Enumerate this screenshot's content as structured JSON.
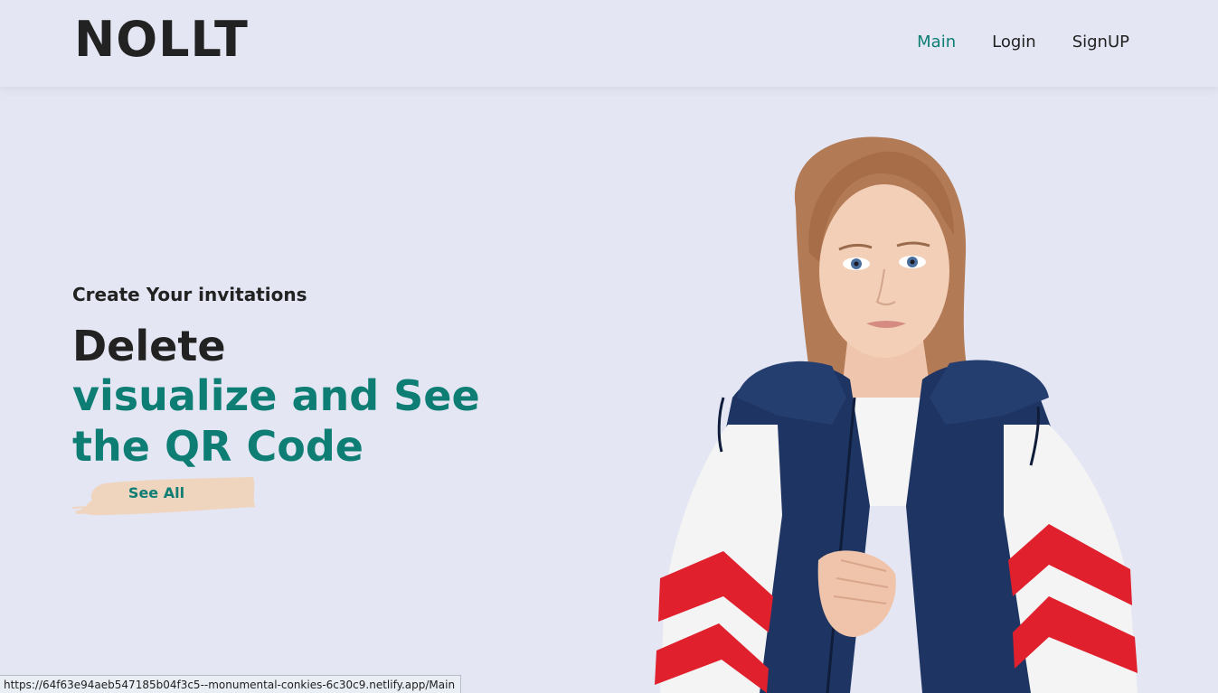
{
  "header": {
    "logo": "NOLLT",
    "nav": [
      {
        "label": "Main",
        "active": true
      },
      {
        "label": "Login",
        "active": false
      },
      {
        "label": "SignUP",
        "active": false
      }
    ]
  },
  "hero": {
    "eyebrow": "Create Your invitations",
    "headline_dark": "Delete",
    "headline_teal_line1": "visualize and See",
    "headline_teal_line2": "the QR Code",
    "cta_label": "See All",
    "image": "model-in-red-white-navy-windbreaker"
  },
  "statusbar": {
    "url": "https://64f63e94aeb547185b04f3c5--monumental-conkies-6c30c9.netlify.app/Main"
  },
  "colors": {
    "background": "#e4e6f3",
    "accent": "#0e7e75",
    "text": "#222222",
    "brush": "#efd5be"
  }
}
